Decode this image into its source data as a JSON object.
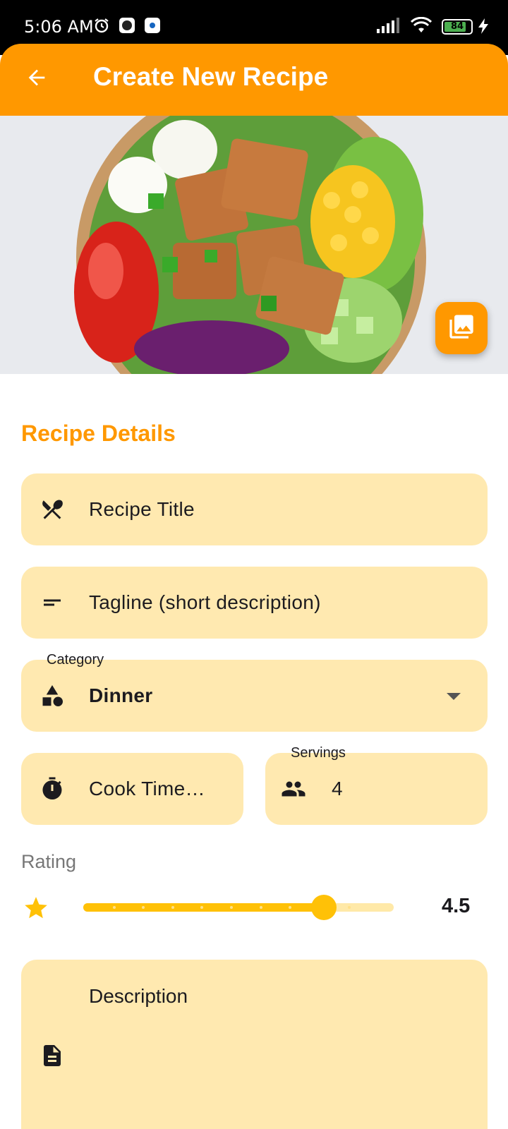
{
  "status_bar": {
    "time": "5:06 AM",
    "battery": "84",
    "icons": [
      "alarm-icon",
      "app-notification-icon",
      "settings-notification-icon",
      "signal-icon",
      "wifi-icon",
      "battery-icon",
      "charging-icon"
    ]
  },
  "app_bar": {
    "title": "Create New Recipe",
    "back_icon": "arrow-back-icon",
    "color": "#ff9800"
  },
  "hero": {
    "image_button_icon": "image-icon"
  },
  "form": {
    "section_title": "Recipe Details",
    "title_field": {
      "placeholder": "Recipe Title",
      "icon": "restaurant-icon"
    },
    "tagline_field": {
      "placeholder": "Tagline (short description)",
      "icon": "short-text-icon"
    },
    "category_field": {
      "label": "Category",
      "value": "Dinner",
      "icon": "category-icon"
    },
    "cook_time_field": {
      "placeholder": "Cook Time…",
      "icon": "timer-icon"
    },
    "servings_field": {
      "label": "Servings",
      "value": "4",
      "icon": "people-icon"
    },
    "rating": {
      "label": "Rating",
      "value_text": "4.5",
      "value": 4.5,
      "max": 5,
      "icon": "star-icon"
    },
    "description_field": {
      "placeholder": "Description",
      "icon": "description-icon"
    }
  },
  "colors": {
    "accent": "#ff9800",
    "field_bg": "#ffe9b0",
    "slider": "#ffc107"
  }
}
